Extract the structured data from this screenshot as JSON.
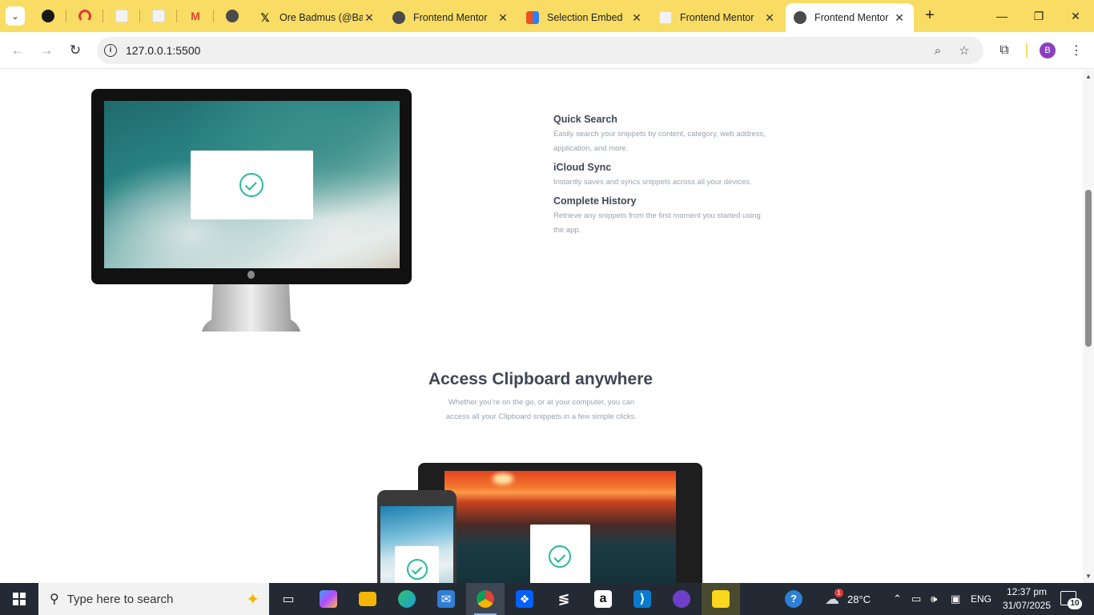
{
  "browser": {
    "tabs": [
      {
        "title": "Ore Badmus (@Ba",
        "favicon": "x-logo-icon",
        "color": "#000000",
        "glyph": "X",
        "active": false
      },
      {
        "title": "Frontend Mentor",
        "favicon": "globe-icon",
        "color": "#4a4a4a",
        "glyph": "",
        "active": false
      },
      {
        "title": "Selection Embed",
        "favicon": "figma-icon",
        "color": "#2f80ed",
        "glyph": "",
        "active": false
      },
      {
        "title": "Frontend Mentor",
        "favicon": "page-icon",
        "color": "#e8e8e8",
        "glyph": "",
        "active": false
      },
      {
        "title": "Frontend Mentor",
        "favicon": "globe-icon",
        "color": "#4a4a4a",
        "glyph": "",
        "active": true
      }
    ],
    "pinned": [
      {
        "name": "github-icon",
        "color": "#181717"
      },
      {
        "name": "speedometer-icon",
        "color": "#e53935"
      },
      {
        "name": "doc-icon",
        "color": "#e8e8e8"
      },
      {
        "name": "doc-icon",
        "color": "#e8e8e8"
      },
      {
        "name": "gmail-icon",
        "color": "#ea4335"
      },
      {
        "name": "globe-icon",
        "color": "#4a4a4a"
      }
    ],
    "url": "127.0.0.1:5500",
    "profile_initial": "B",
    "accent": "#f9dc64"
  },
  "page": {
    "features": [
      {
        "title": "Quick Search",
        "desc": "Easily search your snippets by content, category, web address, application, and more."
      },
      {
        "title": "iCloud Sync",
        "desc": "Instantly saves and syncs snippets across all your devices."
      },
      {
        "title": "Complete History",
        "desc": "Retrieve any snippets from the first moment you started using the app."
      }
    ],
    "access_title": "Access Clipboard anywhere",
    "access_desc": "Whether you’re on the go, or at your computer, you can access all your Clipboard snippets in a few simple clicks.",
    "check_color": "#26ba9c"
  },
  "taskbar": {
    "search_placeholder": "Type here to search",
    "apps": [
      {
        "name": "task-view-icon",
        "glyph": "▭",
        "color": "transparent"
      },
      {
        "name": "copilot-icon",
        "glyph": "◆",
        "color": "#7b61ff"
      },
      {
        "name": "file-explorer-icon",
        "glyph": "▬",
        "color": "#f2b705"
      },
      {
        "name": "edge-icon",
        "glyph": "e",
        "color": "#1c9fd8"
      },
      {
        "name": "mail-icon",
        "glyph": "✉",
        "color": "#2f7fd6"
      },
      {
        "name": "chrome-icon",
        "glyph": "●",
        "color": "#db4437"
      },
      {
        "name": "dropbox-icon",
        "glyph": "❖",
        "color": "#0061fe"
      },
      {
        "name": "capcut-icon",
        "glyph": "≶",
        "color": "#232a33"
      },
      {
        "name": "amazon-icon",
        "glyph": "a",
        "color": "#ffffff"
      },
      {
        "name": "vscode-icon",
        "glyph": "⟩",
        "color": "#0a7acc"
      },
      {
        "name": "github-desktop-icon",
        "glyph": "◉",
        "color": "#6e40c9"
      },
      {
        "name": "sticky-notes-icon",
        "glyph": "▰",
        "color": "#f9d71c"
      }
    ],
    "weather_badge": "1",
    "temperature": "28°C",
    "language": "ENG",
    "time": "12:37 pm",
    "date": "31/07/2025",
    "notifications": "10"
  }
}
